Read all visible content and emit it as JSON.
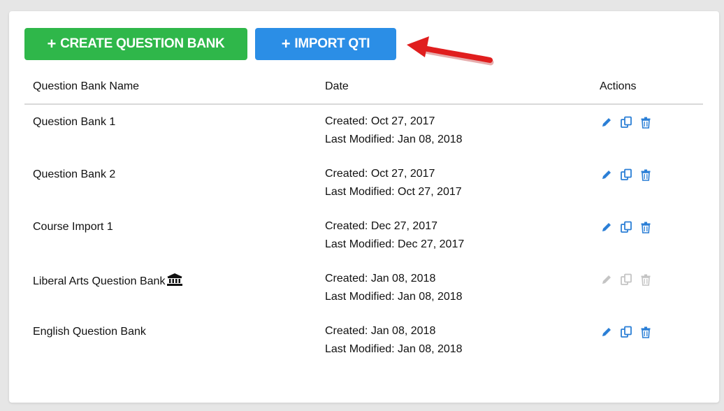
{
  "toolbar": {
    "create_label": "CREATE QUESTION BANK",
    "import_label": "IMPORT QTI"
  },
  "table": {
    "headers": {
      "name": "Question Bank Name",
      "date": "Date",
      "actions": "Actions"
    },
    "rows": [
      {
        "name": "Question Bank 1",
        "created": "Created: Oct 27, 2017",
        "modified": "Last Modified: Jan 08, 2018",
        "disabled": false,
        "institution": false
      },
      {
        "name": "Question Bank 2",
        "created": "Created: Oct 27, 2017",
        "modified": "Last Modified: Oct 27, 2017",
        "disabled": false,
        "institution": false
      },
      {
        "name": "Course Import 1",
        "created": "Created: Dec 27, 2017",
        "modified": "Last Modified: Dec 27, 2017",
        "disabled": false,
        "institution": false
      },
      {
        "name": "Liberal Arts Question Bank",
        "created": "Created: Jan 08, 2018",
        "modified": "Last Modified: Jan 08, 2018",
        "disabled": true,
        "institution": true
      },
      {
        "name": "English Question Bank",
        "created": "Created: Jan 08, 2018",
        "modified": "Last Modified: Jan 08, 2018",
        "disabled": false,
        "institution": false
      }
    ]
  },
  "icons": {
    "edit": "pencil-icon",
    "copy": "copy-icon",
    "delete": "trash-icon",
    "institution": "institution-icon",
    "arrow": "red-arrow-annotation"
  },
  "colors": {
    "create_button": "#2fb74a",
    "import_button": "#2b8ee6",
    "action_icon": "#2b7fd6",
    "action_icon_disabled": "#c4c4c4",
    "annotation_arrow": "#e01e1e"
  }
}
